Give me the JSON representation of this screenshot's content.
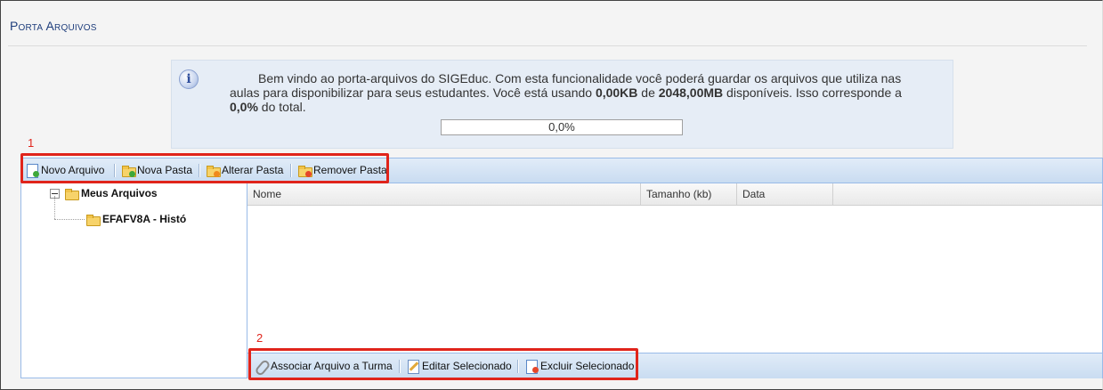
{
  "page": {
    "title": "Porta Arquivos"
  },
  "info": {
    "text_before_used": "Bem vindo ao porta-arquivos do SIGEduc. Com esta funcionalidade você poderá guardar os arquivos que utiliza nas aulas para disponibilizar para seus estudantes. Você está usando ",
    "used": "0,00KB",
    "text_between": " de ",
    "available": "2048,00MB",
    "text_after_available": " disponíveis. Isso corresponde a ",
    "percent": "0,0%",
    "text_end": " do total.",
    "progress_label": "0,0%",
    "progress_value": 0.0
  },
  "markers": {
    "first": "1",
    "second": "2"
  },
  "toolbar": {
    "new_file": "Novo Arquivo",
    "new_folder": "Nova Pasta",
    "rename_folder": "Alterar Pasta",
    "remove_folder": "Remover Pasta"
  },
  "tree": {
    "root": "Meus Arquivos",
    "children": [
      "EFAFV8A - Histó"
    ]
  },
  "grid": {
    "columns": [
      "Nome",
      "Tamanho (kb)",
      "Data"
    ],
    "rows": []
  },
  "bottom_toolbar": {
    "associate": "Associar Arquivo a Turma",
    "edit": "Editar Selecionado",
    "delete": "Excluir Selecionado"
  },
  "icons": {
    "info": "info-icon",
    "new_file": "new-file-icon",
    "new_folder": "new-folder-icon",
    "rename_folder": "rename-folder-icon",
    "remove_folder": "remove-folder-icon",
    "folder": "folder-icon",
    "attach": "paperclip-icon",
    "edit": "edit-icon",
    "delete": "delete-file-icon"
  },
  "colors": {
    "accent": "#1f3e7c",
    "highlight": "#e0241b",
    "toolbar": "#c9dcf1"
  }
}
